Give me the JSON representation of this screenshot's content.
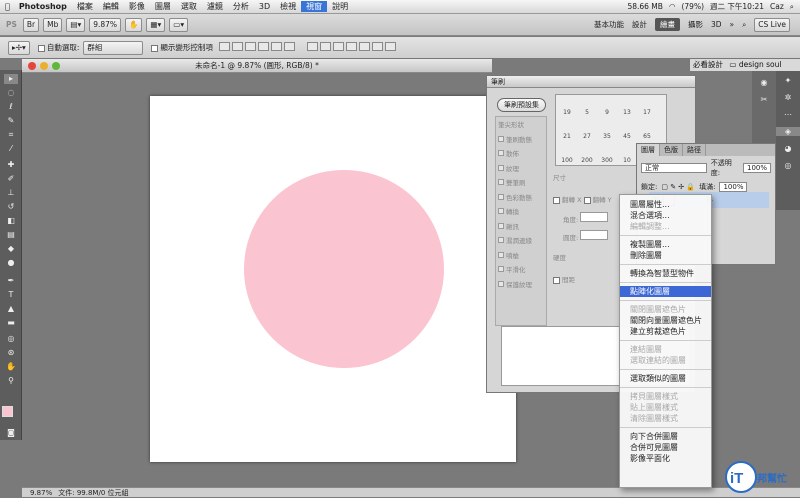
{
  "menubar": {
    "apple": "",
    "app": "Photoshop",
    "items": [
      "檔案",
      "編輯",
      "影像",
      "圖層",
      "選取",
      "濾鏡",
      "分析",
      "3D",
      "檢視",
      "視窗",
      "說明"
    ],
    "highlighted": "視窗",
    "status": {
      "memory": "58.66 MB",
      "battery": "(79%)",
      "clock": "週二 下午10:21",
      "user": "Caz"
    }
  },
  "appbar": {
    "ps": "PS",
    "br": "Br",
    "mb": "Mb",
    "zoom": "9.87%",
    "workspaces": [
      "基本功能",
      "設計",
      "繪畫",
      "攝影",
      "3D"
    ],
    "active_ws": "繪畫",
    "more": "»",
    "cslive": "CS Live"
  },
  "options": {
    "auto_select": "自動選取:",
    "group": "群組",
    "show_transform": "顯示變形控制項"
  },
  "doc": {
    "title": "未命名-1 @ 9.87% (圓形, RGB/8) *"
  },
  "status": {
    "zoom": "9.87%",
    "file": "文件: 99.8M/0 位元組"
  },
  "brush": {
    "tab": "筆刷",
    "preset_btn": "筆刷預設集",
    "list": [
      "筆尖形狀",
      "筆刷動態",
      "散佈",
      "紋理",
      "雙筆刷",
      "色彩動態",
      "轉換",
      "雜訊",
      "濕潤邊緣",
      "噴槍",
      "平滑化",
      "保護紋理"
    ],
    "sizes": [
      [
        "19",
        "5",
        "9",
        "13",
        "17"
      ],
      [
        "21",
        "27",
        "35",
        "45",
        "65"
      ],
      [
        "100",
        "200",
        "300",
        "10",
        "30"
      ]
    ],
    "labels": {
      "size": "尺寸",
      "flip_x": "翻轉 X",
      "flip_y": "翻轉 Y",
      "angle": "角度:",
      "roundness": "圓度:",
      "hardness": "硬度",
      "spacing": "間距"
    }
  },
  "layers": {
    "tabs": [
      "圖層",
      "色版",
      "路徑"
    ],
    "mode": "正常",
    "opacity_label": "不透明度:",
    "opacity": "100%",
    "lock_label": "鎖定:",
    "fill_label": "填滿:",
    "fill": "100%",
    "layer_name": "形"
  },
  "dock": {
    "design_soul": "design soul",
    "mustsee": "必看設計"
  },
  "context_menu": [
    {
      "label": "圖層屬性...",
      "state": "normal"
    },
    {
      "label": "混合選項...",
      "state": "normal"
    },
    {
      "label": "編輯調整...",
      "state": "disabled"
    },
    {
      "sep": true
    },
    {
      "label": "複製圖層...",
      "state": "normal"
    },
    {
      "label": "刪除圖層",
      "state": "normal"
    },
    {
      "sep": true
    },
    {
      "label": "轉換為智慧型物件",
      "state": "normal"
    },
    {
      "sep": true
    },
    {
      "label": "點陣化圖層",
      "state": "selected"
    },
    {
      "sep": true
    },
    {
      "label": "關閉圖層遮色片",
      "state": "disabled"
    },
    {
      "label": "關閉向量圖層遮色片",
      "state": "normal"
    },
    {
      "label": "建立剪裁遮色片",
      "state": "normal"
    },
    {
      "sep": true
    },
    {
      "label": "連結圖層",
      "state": "disabled"
    },
    {
      "label": "選取連結的圖層",
      "state": "disabled"
    },
    {
      "sep": true
    },
    {
      "label": "選取類似的圖層",
      "state": "normal"
    },
    {
      "sep": true
    },
    {
      "label": "拷貝圖層樣式",
      "state": "disabled"
    },
    {
      "label": "貼上圖層樣式",
      "state": "disabled"
    },
    {
      "label": "清除圖層樣式",
      "state": "disabled"
    },
    {
      "sep": true
    },
    {
      "label": "向下合併圖層",
      "state": "normal"
    },
    {
      "label": "合併可見圖層",
      "state": "normal"
    },
    {
      "label": "影像平面化",
      "state": "normal"
    }
  ],
  "watermark": {
    "it": "iT",
    "rest": "邦幫忙"
  },
  "colors": {
    "circle": "#fbc4d1",
    "selection": "#3c67d4"
  }
}
